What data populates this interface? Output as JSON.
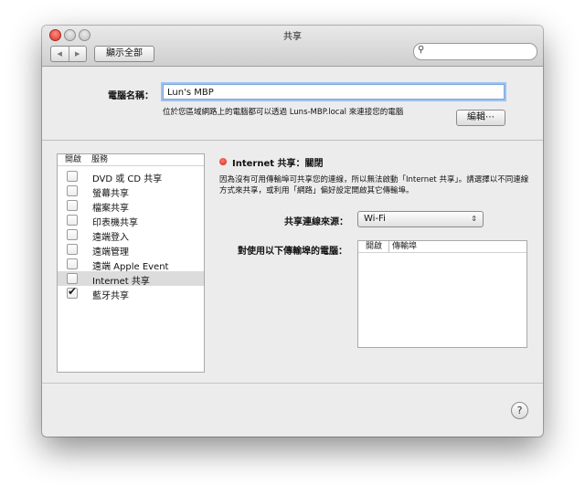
{
  "window": {
    "title": "共享",
    "nav_back_icon": "◀",
    "nav_forward_icon": "▶",
    "show_all_label": "顯示全部",
    "search_icon": "🔍"
  },
  "computer_name": {
    "label": "電腦名稱：",
    "value": "Lun's MBP",
    "hint": "位於您區域網路上的電腦都可以透過 Luns-MBP.local 來連接您的電腦",
    "edit_button": "編輯⋯"
  },
  "services": {
    "header_on": "開啟",
    "header_service": "服務",
    "items": [
      {
        "label": "DVD 或 CD 共享",
        "checked": false,
        "selected": false
      },
      {
        "label": "螢幕共享",
        "checked": false,
        "selected": false
      },
      {
        "label": "檔案共享",
        "checked": false,
        "selected": false
      },
      {
        "label": "印表機共享",
        "checked": false,
        "selected": false
      },
      {
        "label": "遠端登入",
        "checked": false,
        "selected": false
      },
      {
        "label": "遠端管理",
        "checked": false,
        "selected": false
      },
      {
        "label": "遠端 Apple Event",
        "checked": false,
        "selected": false
      },
      {
        "label": "Internet 共享",
        "checked": false,
        "selected": true
      },
      {
        "label": "藍牙共享",
        "checked": true,
        "selected": false
      }
    ]
  },
  "detail": {
    "status": "Internet 共享：關閉",
    "status_color": "#d32418",
    "description": "因為沒有可用傳輸埠可共享您的連線，所以無法啟動「Internet 共享」。請選擇以不同連線方式來共享，或利用「網路」偏好設定開啟其它傳輸埠。",
    "source_label": "共享連線來源：",
    "source_value": "Wi-Fi",
    "ports_label": "對使用以下傳輸埠的電腦：",
    "ports_header_on": "開啟",
    "ports_header_port": "傳輸埠"
  },
  "help_label": "?"
}
